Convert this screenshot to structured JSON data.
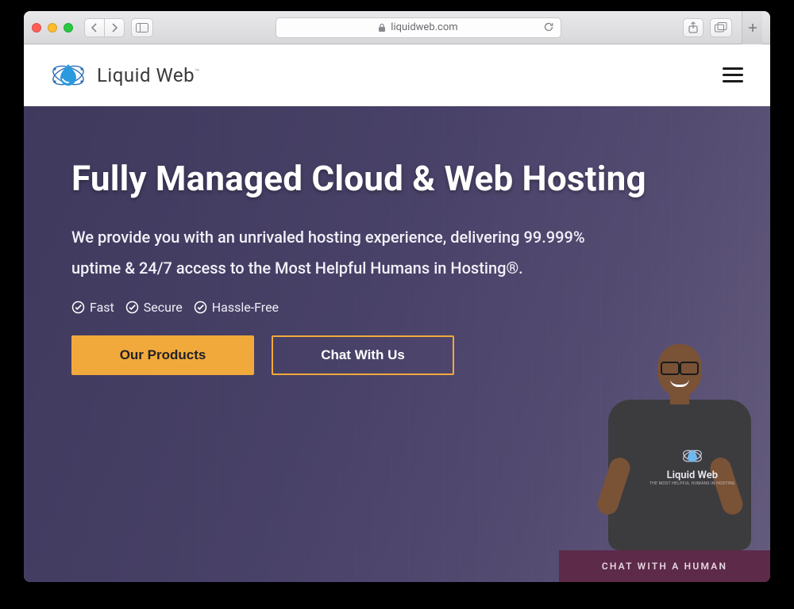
{
  "browser": {
    "address_domain": "liquidweb.com"
  },
  "site": {
    "brand_name": "Liquid Web",
    "brand_tm": "™"
  },
  "hero": {
    "heading": "Fully Managed Cloud & Web Hosting",
    "lead": "We provide you with an unrivaled hosting experience, delivering 99.999% uptime & 24/7 access to the Most Helpful Humans in Hosting®.",
    "badges": [
      "Fast",
      "Secure",
      "Hassle-Free"
    ],
    "primary_cta": "Our Products",
    "secondary_cta": "Chat With Us"
  },
  "person_shirt": {
    "line1": "Liquid Web",
    "line2": "THE MOST HELPFUL HUMANS IN HOSTING"
  },
  "chat_bar_label": "CHAT WITH A HUMAN"
}
